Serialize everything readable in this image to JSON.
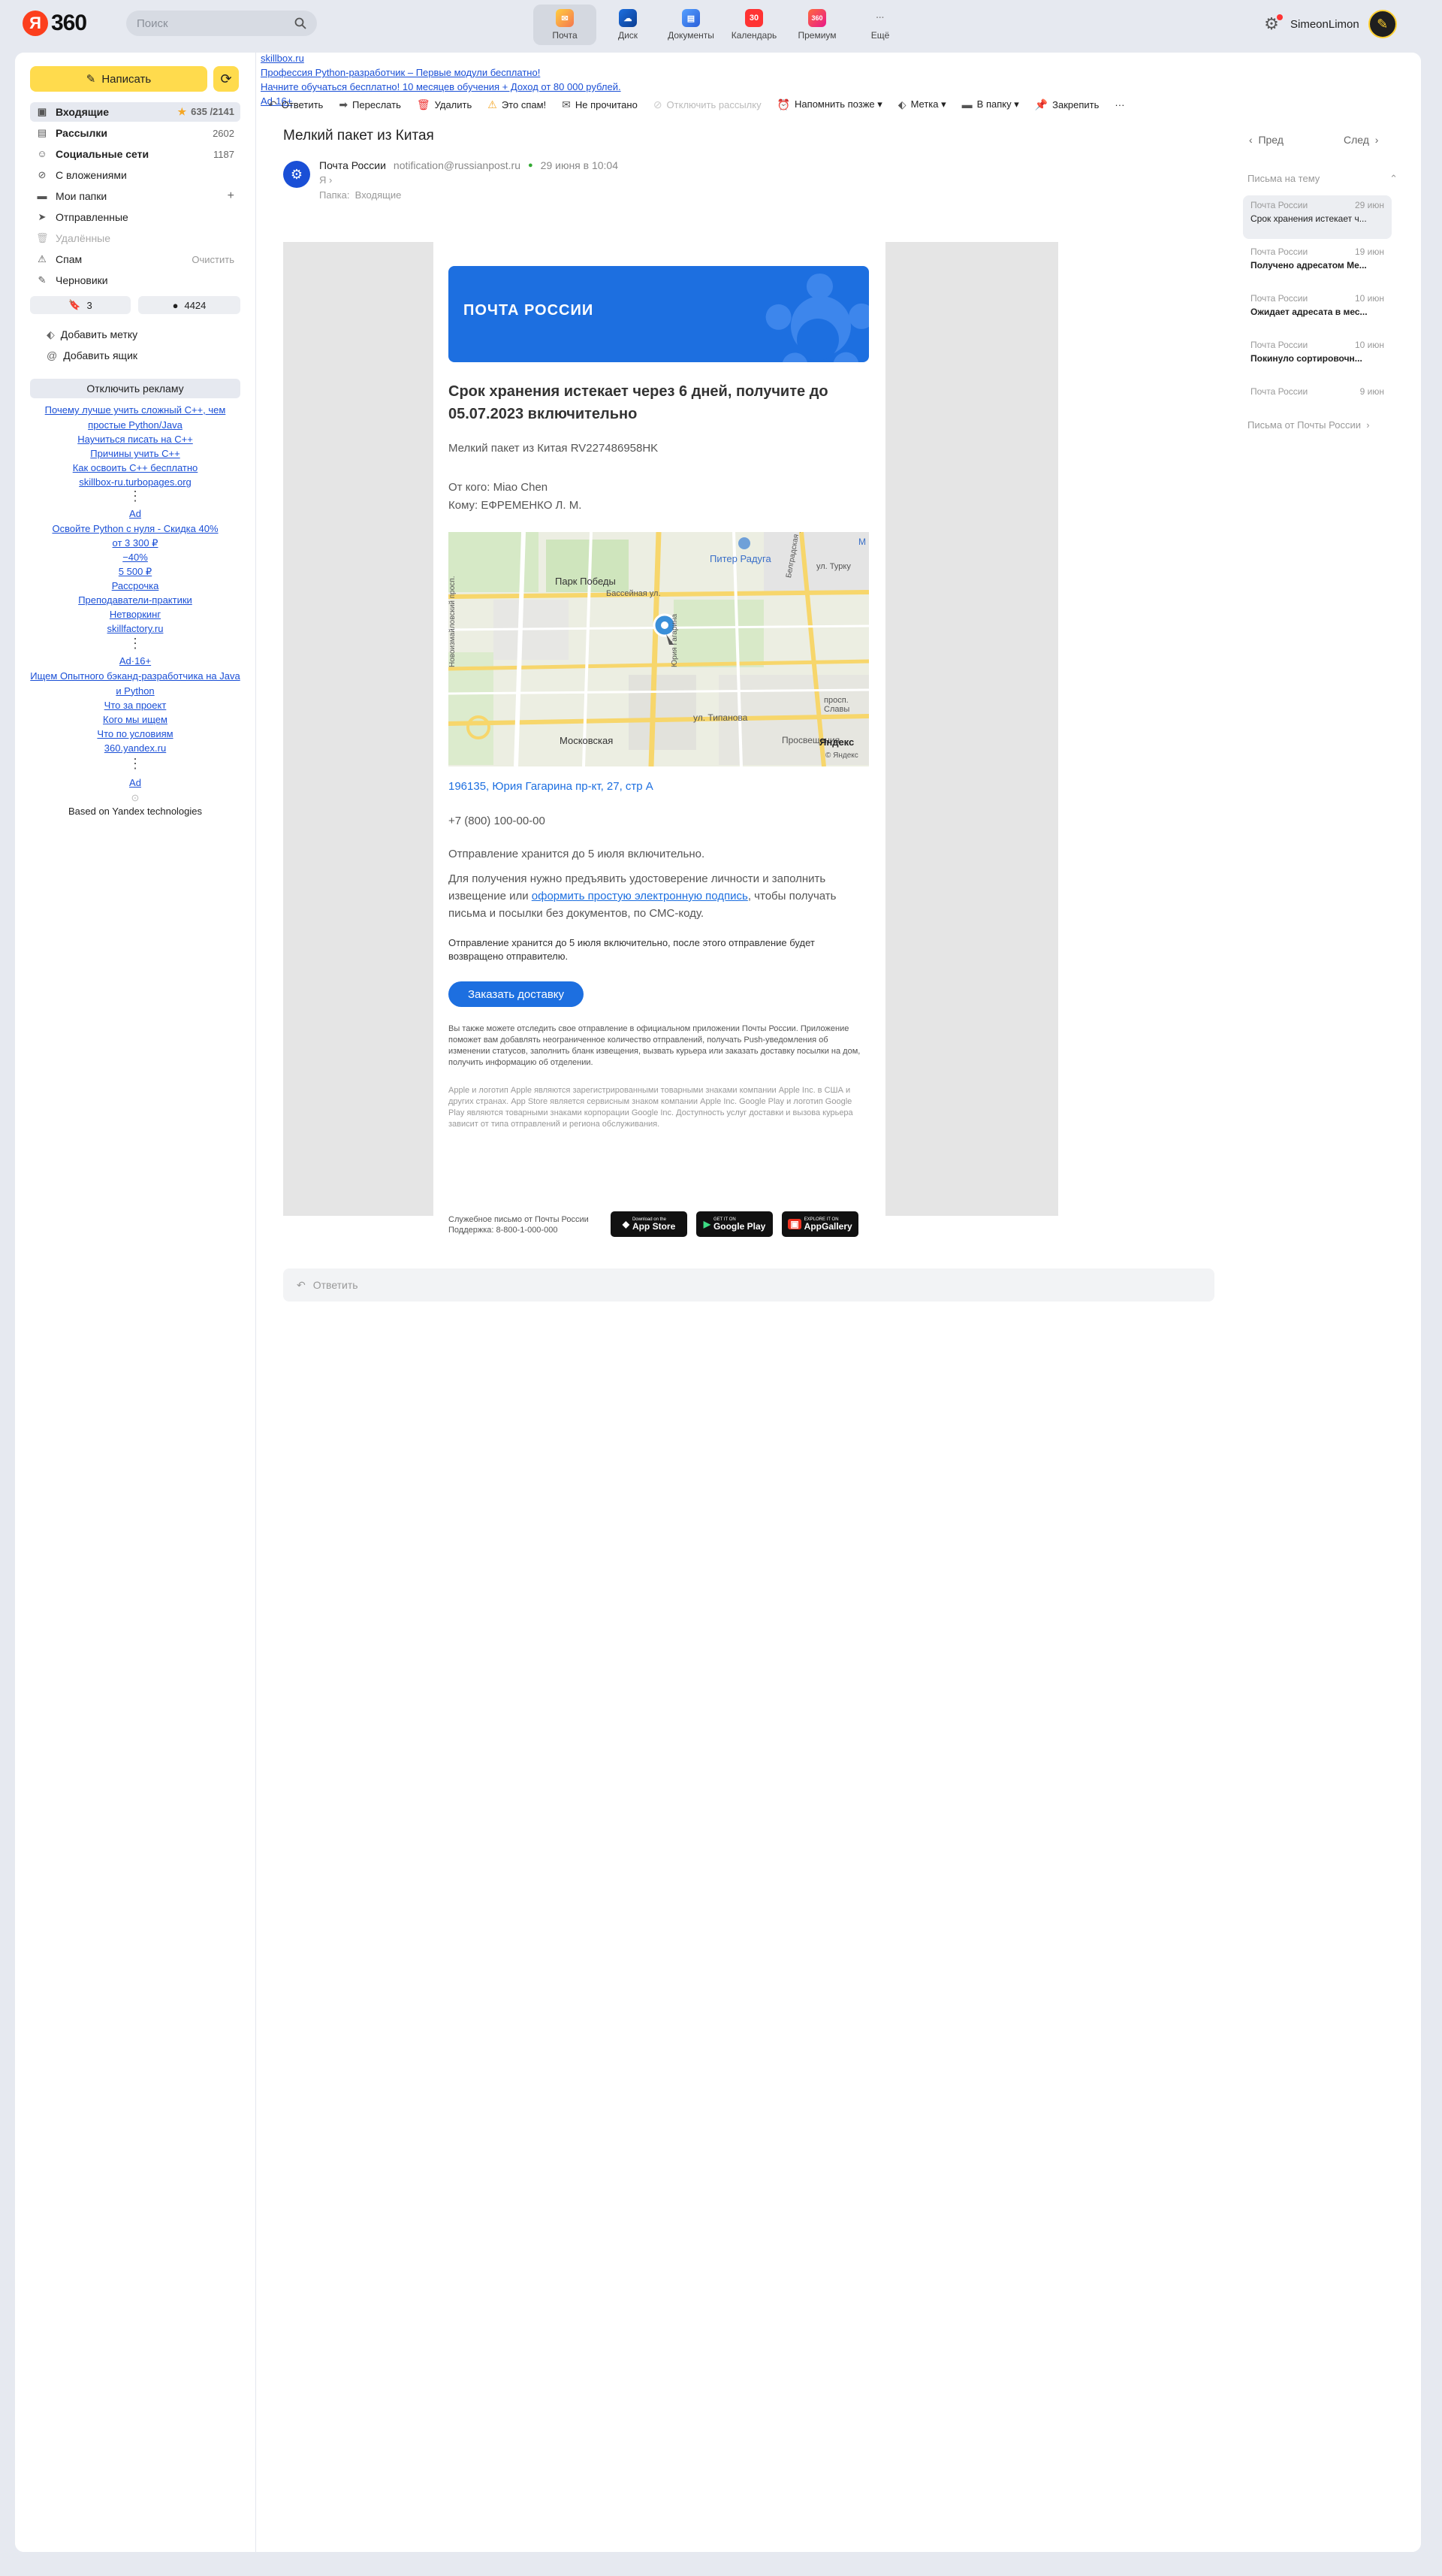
{
  "header": {
    "logo_letter": "Я",
    "logo_text": "360",
    "search_placeholder": "Поиск",
    "services": [
      {
        "label": "Почта",
        "icon": "mail-icon",
        "color": "#f5a623"
      },
      {
        "label": "Диск",
        "icon": "disk-icon",
        "color": "#1d6fe0"
      },
      {
        "label": "Документы",
        "icon": "documents-icon",
        "color": "#2b7de9"
      },
      {
        "label": "Календарь",
        "icon": "calendar-icon",
        "color": "#f33",
        "badge": "30"
      },
      {
        "label": "Премиум",
        "icon": "premium-icon",
        "color": "#f44",
        "badge": "360"
      },
      {
        "label": "Ещё",
        "icon": "more-icon",
        "badge": "···"
      }
    ],
    "username": "SimeonLimon"
  },
  "sidebar": {
    "compose_label": "Написать",
    "folders": [
      {
        "label": "Входящие",
        "count": "635 /2141",
        "icon": "inbox-icon"
      },
      {
        "label": "Рассылки",
        "count": "2602",
        "icon": "newsletters-icon"
      },
      {
        "label": "Социальные сети",
        "count": "1187",
        "icon": "social-icon"
      },
      {
        "label": "С вложениями",
        "count": "",
        "icon": "attachment-icon"
      },
      {
        "label": "Мои папки",
        "count": "+",
        "icon": "folder-icon"
      },
      {
        "label": "Отправленные",
        "count": "",
        "icon": "sent-icon"
      },
      {
        "label": "Удалённые",
        "count": "",
        "icon": "trash-icon"
      },
      {
        "label": "Спам",
        "count": "Очистить",
        "icon": "spam-icon"
      },
      {
        "label": "Черновики",
        "count": "",
        "icon": "drafts-icon"
      }
    ],
    "chip_marks": "3",
    "chip_unread": "4424",
    "add_label": "Добавить метку",
    "add_box": "Добавить ящик",
    "disable_ads": "Отключить рекламу",
    "ads1": [
      "Почему лучше учить сложный C++, чем простые Python/Java",
      "Научиться писать на C++",
      "Причины учить C++",
      "Как освоить C++ бесплатно",
      "skillbox-ru.turbopages.org"
    ],
    "ad_sep": "⋮",
    "ad_label": "Ad",
    "ads2": [
      "Освойте Python с нуля - Скидка 40%",
      "от 3 300 ₽",
      "−40%",
      "5 500 ₽",
      "Рассрочка",
      "Преподаватели-практики",
      "Нетворкинг",
      "skillfactory.ru"
    ],
    "ad16": "Ad·16+",
    "ads3": [
      "Ищем Опытного бэканд-разработчика на Java и Python",
      "Что за проект",
      "Кого мы ищем",
      "Что по условиям",
      "360.yandex.ru"
    ],
    "based": "Based on Yandex technologies"
  },
  "adbar": {
    "line1": "skillbox.ru",
    "line2": "Профессия Python-разработчик – Первые модули бесплатно!",
    "line3": "Начните обучаться бесплатно! 10 месяцев обучения + Доход от 80 000 рублей.",
    "line4": "Ad·16+"
  },
  "toolbar": [
    {
      "label": "Ответить",
      "icon": "reply-icon"
    },
    {
      "label": "Переслать",
      "icon": "forward-icon"
    },
    {
      "label": "Удалить",
      "icon": "delete-icon"
    },
    {
      "label": "Это спам!",
      "icon": "spam-icon"
    },
    {
      "label": "Не прочитано",
      "icon": "unread-icon"
    },
    {
      "label": "Отключить рассылку",
      "icon": "unsubscribe-icon",
      "disabled": true
    },
    {
      "label": "Напомнить позже ▾",
      "icon": "remind-icon"
    },
    {
      "label": "Метка ▾",
      "icon": "label-icon"
    },
    {
      "label": "В папку ▾",
      "icon": "move-folder-icon"
    },
    {
      "label": "Закрепить",
      "icon": "pin-icon"
    },
    {
      "label": "···",
      "icon": "more-icon"
    }
  ],
  "message": {
    "subject": "Мелкий пакет из Китая",
    "prev": "Пред",
    "next": "След",
    "sender_name": "Почта России",
    "sender_email": "notification@russianpost.ru",
    "date": "29 июня в 10:04",
    "to": "Я",
    "folder_label": "Папка:",
    "folder": "Входящие"
  },
  "letter": {
    "banner": "ПОЧТА РОССИИ",
    "title": "Срок хранения истекает через 6 дней, получите до 05.07.2023 включительно",
    "parcel": "Мелкий пакет из Китая RV227486958HK",
    "from": "От кого: Miao Chen",
    "to": "Кому: ЕФРЕМЕНКО Л. М.",
    "map_labels": [
      "Парк Победы",
      "Питер Радуга",
      "Бассейная ул.",
      "Московская",
      "ул. Типанова",
      "Просвещения",
      "Яндекс",
      "© Яндекс",
      "ул. Турку",
      "просп. Славы",
      "Новоизмайловский просп.",
      "Белградская ул.",
      "Юрия Гагарина",
      "М"
    ],
    "address": "196135, Юрия Гагарина пр-кт, 27, стр А",
    "phone": "+7 (800) 100-00-00",
    "store": "Отправление хранится до 5 июля включительно.",
    "need_1": "Для получения нужно предъявить удостоверение личности и заполнить извещение или ",
    "need_link": "оформить простую электронную подпись",
    "need_2": ", чтобы получать письма и посылки без документов, по СМС-коду.",
    "store2": "Отправление хранится до 5 июля включительно, после этого отправление будет возвращено отправителю.",
    "order_button": "Заказать доставку",
    "app_text": "Вы также можете отследить свое отправление в официальном приложении Почты России. Приложение поможет вам добавлять неограниченное количество отправлений, получать Push-уведомления об изменении статусов, заполнить бланк извещения, вызвать курьера или заказать доставку посылки на дом, получить информацию об отделении.",
    "apple_text": "Apple и логотип Apple являются зарегистрированными товарными знаками компании Apple Inc. в США и других странах. App Store является сервисным знаком компании Apple Inc. Google Play и логотип Google Play являются товарными знаками корпорации Google Inc. Доступность услуг доставки и вызова курьера зависит от типа отправлений и региона обслуживания.",
    "service_1": "Служебное письмо от Почты России",
    "service_2": "Поддержка: 8-800-1-000-000",
    "stores": [
      {
        "small": "Download on the",
        "label": "App Store"
      },
      {
        "small": "GET IT ON",
        "label": "Google Play"
      },
      {
        "small": "EXPLORE IT ON",
        "label": "AppGallery"
      }
    ]
  },
  "thread": {
    "header": "Письма на тему",
    "items": [
      {
        "from": "Почта России",
        "date": "29 июн",
        "subject": "Срок хранения истекает ч..."
      },
      {
        "from": "Почта России",
        "date": "19 июн",
        "subject": "Получено адресатом Ме..."
      },
      {
        "from": "Почта России",
        "date": "10 июн",
        "subject": "Ожидает адресата в мес..."
      },
      {
        "from": "Почта России",
        "date": "10 июн",
        "subject": "Покинуло сортировочн..."
      },
      {
        "from": "Почта России",
        "date": "9 июн",
        "subject": ""
      }
    ],
    "from_sender": "Письма от Почты России"
  },
  "reply": {
    "label": "Ответить"
  }
}
